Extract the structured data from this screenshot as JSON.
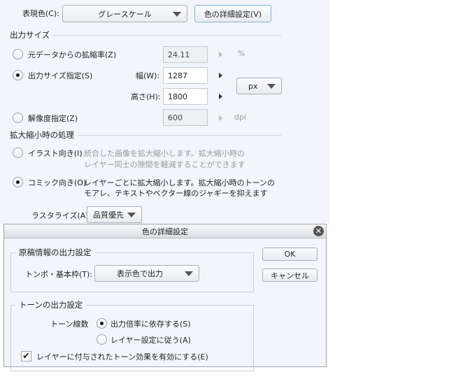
{
  "color_mode": {
    "label": "表現色(C):",
    "value": "グレースケール",
    "detail_button": "色の詳細設定(V)"
  },
  "output_size": {
    "title": "出力サイズ",
    "scale_option": {
      "label": "元データからの拡縮率(Z)",
      "value": "24.11",
      "unit": "%",
      "selected": false
    },
    "size_option": {
      "label": "出力サイズ指定(S)",
      "selected": true,
      "width_label": "幅(W):",
      "width": "1287",
      "height_label": "高さ(H):",
      "height": "1800",
      "unit": "px"
    },
    "resolution_option": {
      "label": "解像度指定(Z)",
      "value": "600",
      "unit": "dpi",
      "selected": false
    }
  },
  "scaling": {
    "title": "拡大縮小時の処理",
    "illust": {
      "label": "イラスト向き(I)",
      "desc1": "統合した画像を拡大縮小します。拡大縮小時の",
      "desc2": "レイヤー同士の隙間を軽減することができます",
      "selected": false
    },
    "comic": {
      "label": "コミック向き(O)",
      "desc1": "レイヤーごとに拡大縮小します。拡大縮小時のトーンの",
      "desc2": "モアレ、テキストやベクター線のジャギーを抑えます",
      "selected": true
    },
    "rasterize_label": "ラスタライズ(A):",
    "rasterize_value": "品質優先"
  },
  "dialog": {
    "title": "色の詳細設定",
    "ok": "OK",
    "cancel": "キャンセル",
    "manuscript": {
      "title": "原稿情報の出力設定",
      "crop_label": "トンボ・基本枠(T):",
      "crop_value": "表示色で出力"
    },
    "tone": {
      "title": "トーンの出力設定",
      "lines_label": "トーン線数",
      "opt1": "出力倍率に依存する(S)",
      "opt2": "レイヤー設定に従う(A)",
      "opt1_selected": true,
      "checkbox": "レイヤーに付与されたトーン効果を有効にする(E)",
      "checkbox_checked": true
    }
  }
}
